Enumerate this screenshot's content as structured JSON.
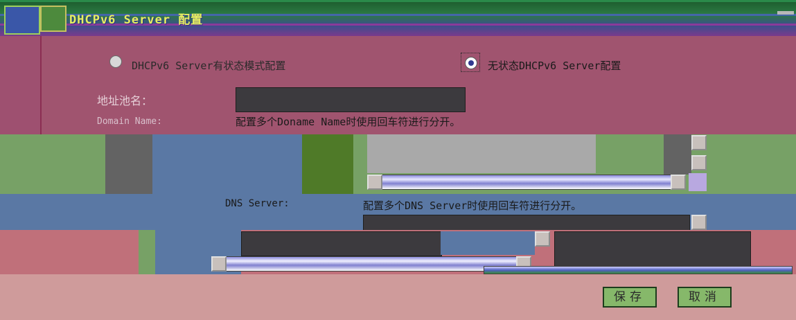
{
  "window": {
    "title": "DHCPv6 Server 配置"
  },
  "mode": {
    "option_stateful_label": "DHCPv6 Server有状态模式配置",
    "option_stateless_label": "无状态DHCPv6 Server配置",
    "selected": "stateless"
  },
  "form": {
    "pool_name_label": "地址池名：",
    "pool_name_value": "",
    "domain_name_label": "Domain Name:",
    "domain_name_hint": "配置多个Doname Name时使用回车符进行分开。",
    "dns_server_label": "DNS Server:",
    "dns_server_hint": "配置多个DNS Server时使用回车符进行分开。"
  },
  "buttons": {
    "save_label": "保存",
    "cancel_label": "取消"
  },
  "colors": {
    "title_text": "#e8f060",
    "top_panel": "#a0546f",
    "green_band": "#77a166",
    "blue_band": "#5a78a4",
    "button_bg": "#86b86a"
  }
}
